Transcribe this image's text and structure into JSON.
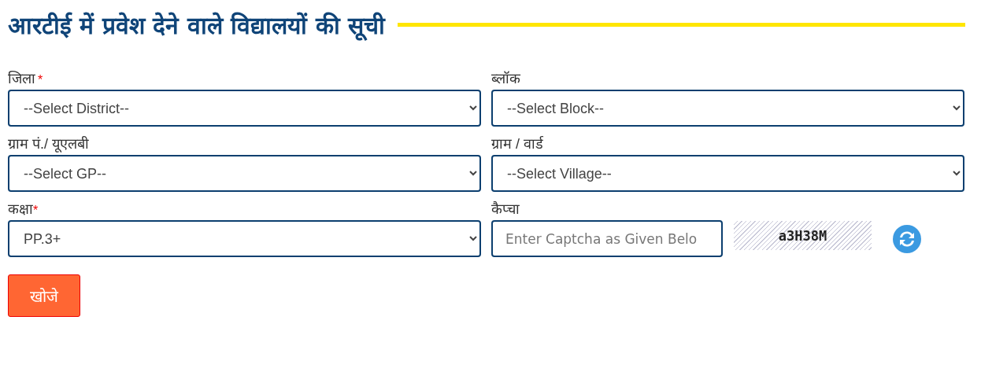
{
  "heading": "आरटीई में प्रवेश देने वाले विद्यालयों की सूची",
  "fields": [
    {
      "kind": "select",
      "label": "जिला",
      "required_mark": "*",
      "value": "--Select District--"
    },
    {
      "kind": "select",
      "label": "ब्लॉक",
      "value": "--Select Block--"
    },
    {
      "kind": "select",
      "label": "ग्राम पं./ यूएलबी",
      "value": "--Select GP--"
    },
    {
      "kind": "select",
      "label": "ग्राम / वार्ड",
      "value": "--Select Village--"
    },
    {
      "kind": "select",
      "label": "कक्षा",
      "required_mark": "*",
      "value": "PP.3+"
    },
    {
      "kind": "captcha",
      "label": "कैप्चा",
      "placeholder": "Enter Captcha as Given Belo",
      "captcha_text": "a3H38M"
    }
  ],
  "search_button": "खोजे"
}
